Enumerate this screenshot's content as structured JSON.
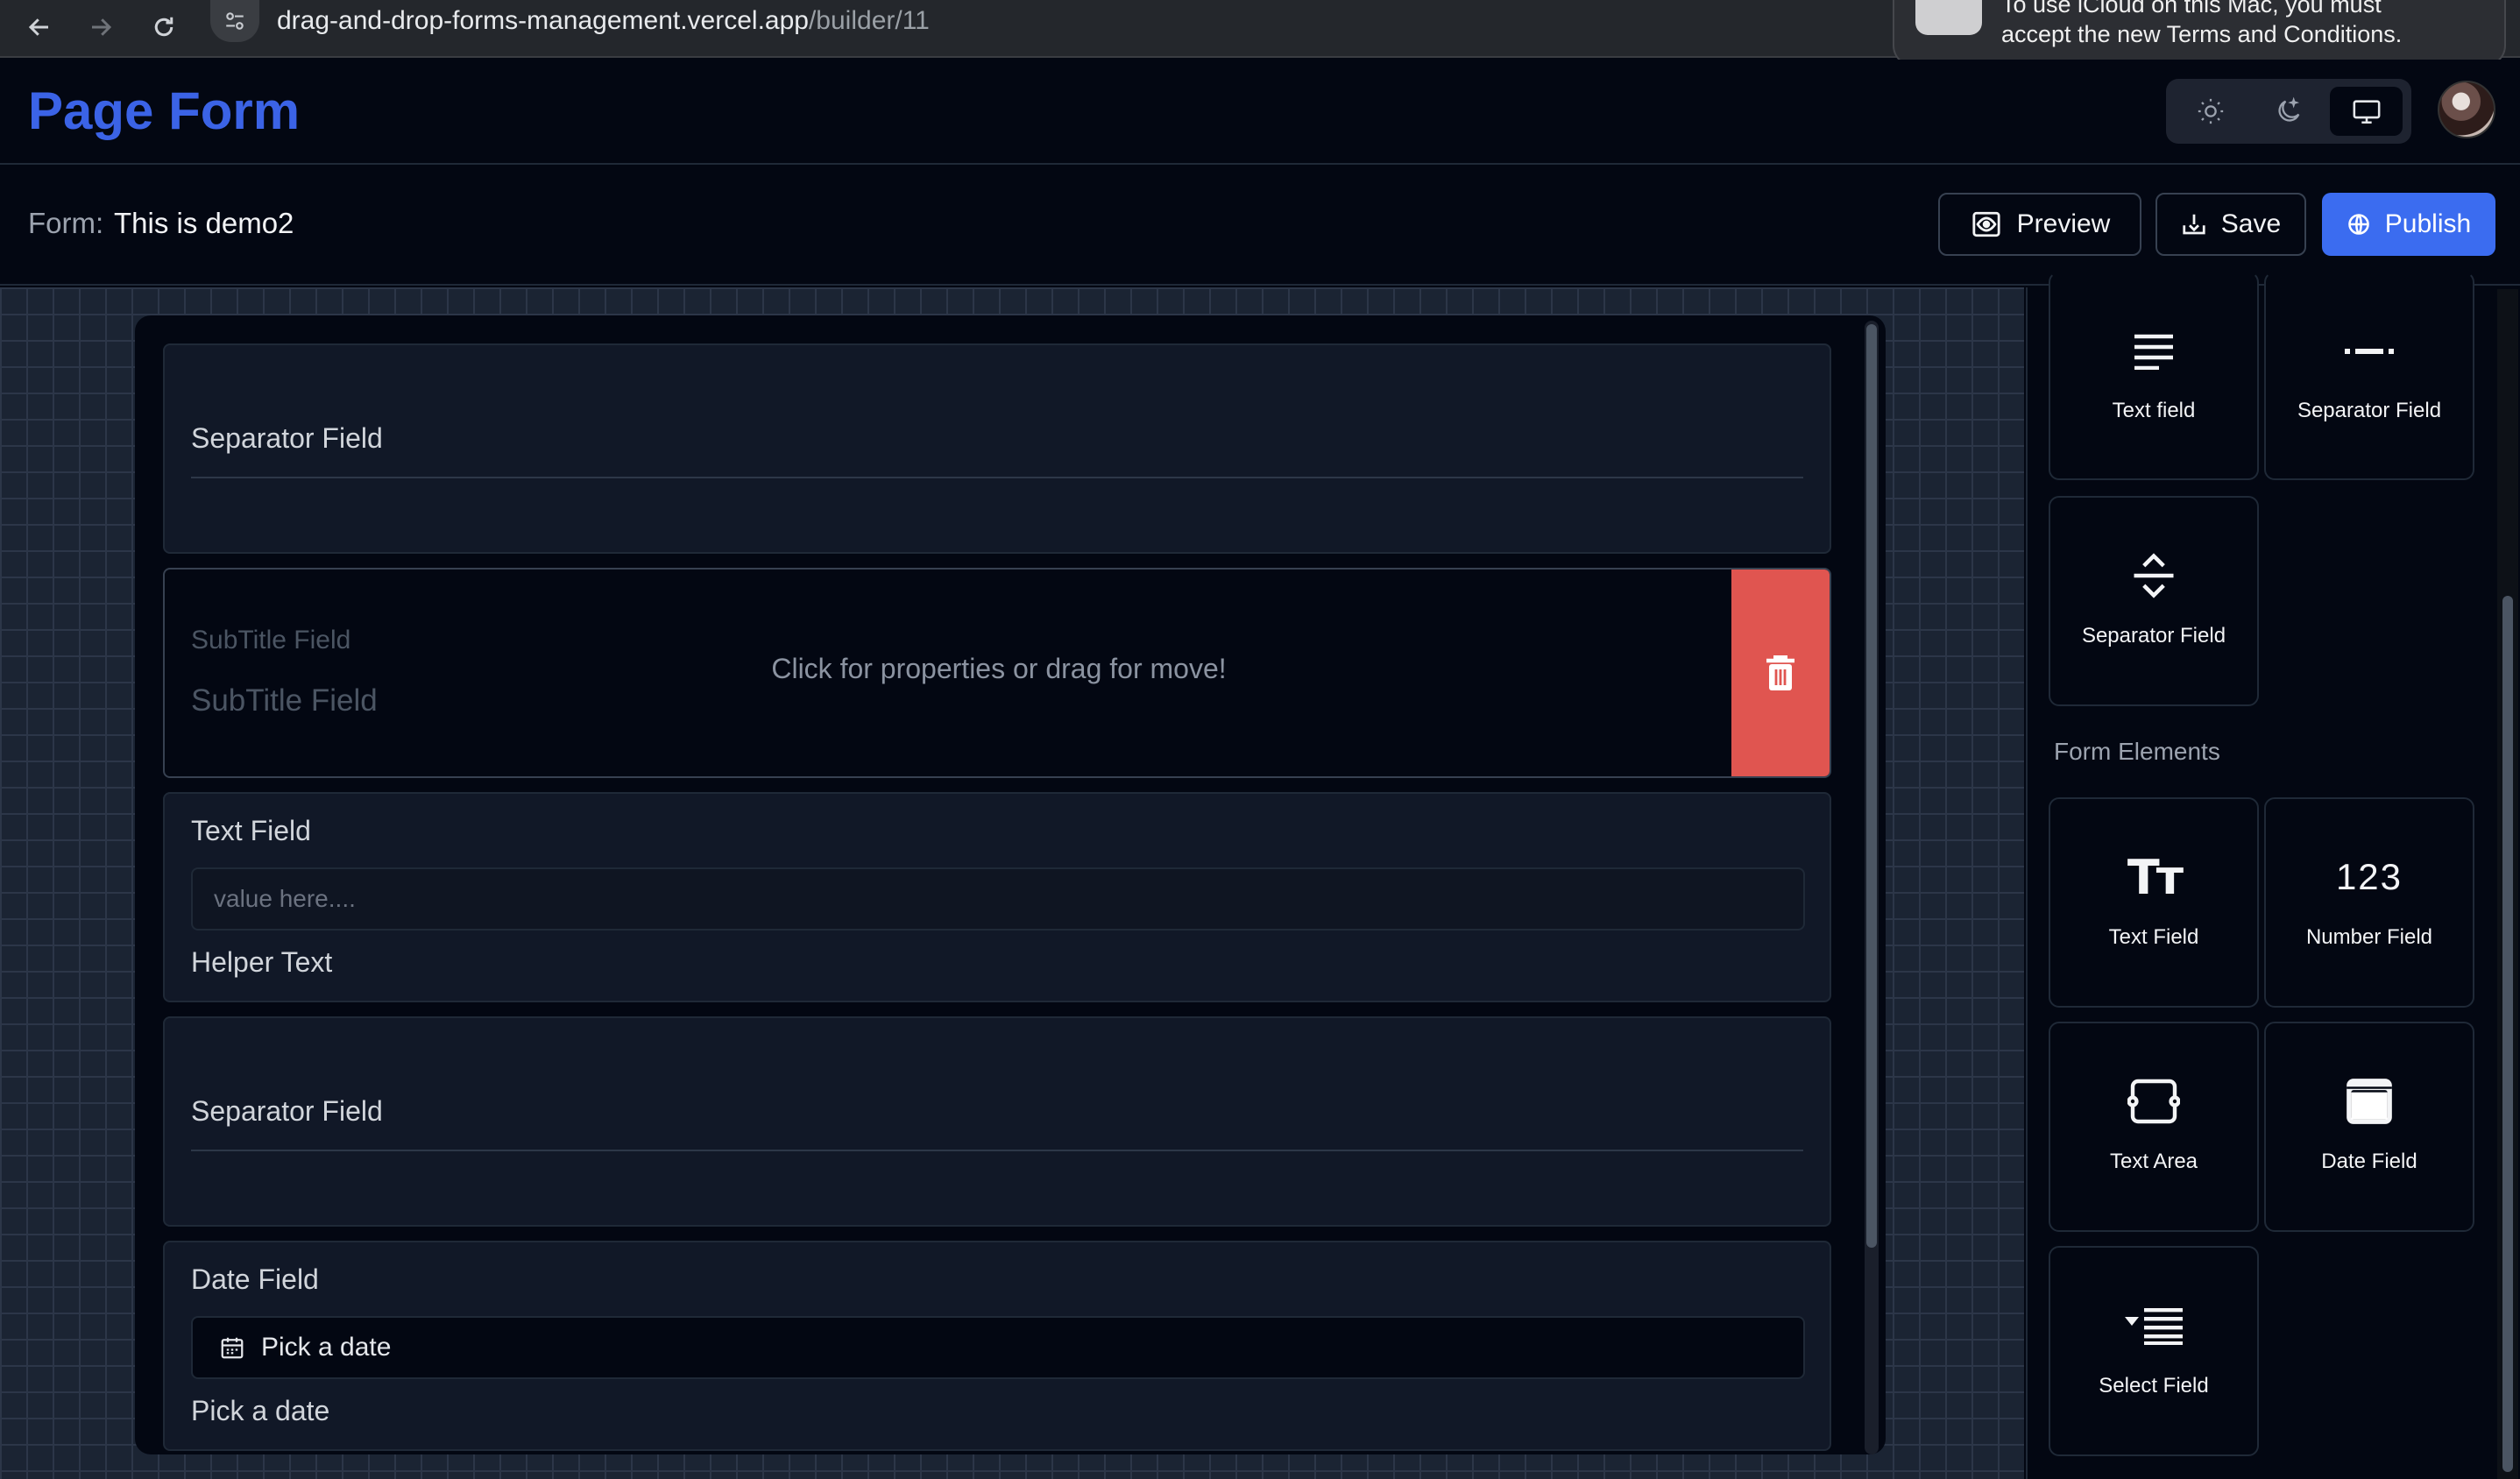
{
  "browser": {
    "url_host": "drag-and-drop-forms-management.vercel.app",
    "url_path": "/builder/11",
    "notification_line1": "To use iCloud on this Mac, you must",
    "notification_line2": "accept the new Terms and Conditions."
  },
  "header": {
    "title": "Page Form"
  },
  "form_bar": {
    "label": "Form:",
    "name": "This is demo2",
    "preview_label": "Preview",
    "save_label": "Save",
    "publish_label": "Publish"
  },
  "colors": {
    "accent": "#3b63e6",
    "publish": "#3b6cf0",
    "delete": "#e05550",
    "background": "#030712"
  },
  "fields": {
    "separator1": {
      "label": "Separator Field"
    },
    "subtitle": {
      "label_small": "SubTitle Field",
      "label_large": "SubTitle Field",
      "hint": "Click for properties or drag for move!"
    },
    "text": {
      "label": "Text Field",
      "placeholder": "value here....",
      "helper": "Helper Text"
    },
    "separator2": {
      "label": "Separator Field"
    },
    "date": {
      "label": "Date Field",
      "input_text": "Pick a date",
      "helper": "Pick a date"
    }
  },
  "sidebar": {
    "layout_tools": [
      {
        "label": "Text field",
        "icon": "paragraph-icon"
      },
      {
        "label": "Separator Field",
        "icon": "separator-dash-icon"
      },
      {
        "label": "Separator Field",
        "icon": "separator-arrows-icon"
      }
    ],
    "form_elements_heading": "Form Elements",
    "form_elements": [
      {
        "label": "Text Field",
        "icon": "text-icon",
        "glyph": "Tт"
      },
      {
        "label": "Number Field",
        "icon": "number-icon",
        "glyph": "123"
      },
      {
        "label": "Text Area",
        "icon": "textarea-icon"
      },
      {
        "label": "Date Field",
        "icon": "calendar-icon"
      },
      {
        "label": "Select Field",
        "icon": "select-list-icon"
      }
    ]
  }
}
